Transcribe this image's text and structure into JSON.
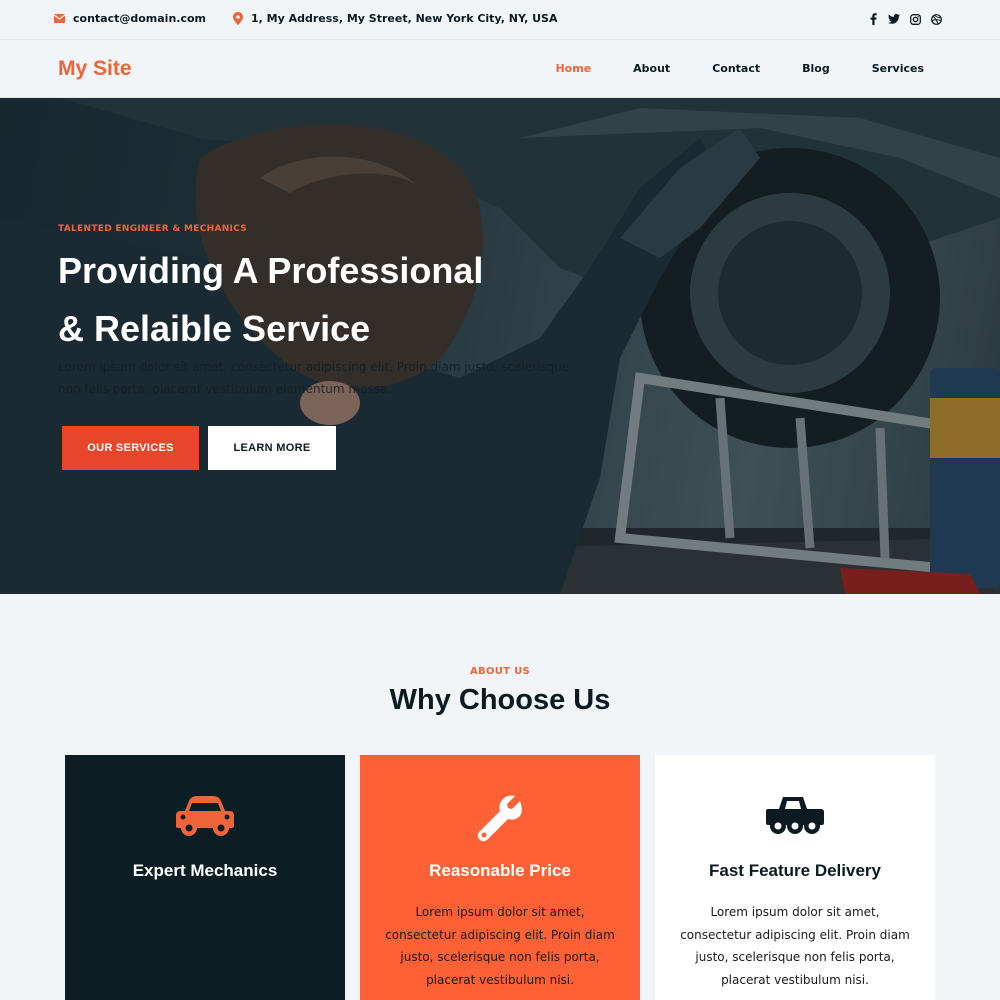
{
  "topbar": {
    "email": "contact@domain.com",
    "address": "1, My Address, My Street, New York City, NY, USA",
    "social": [
      "facebook-icon",
      "twitter-icon",
      "instagram-icon",
      "dribbble-icon"
    ]
  },
  "nav": {
    "brand": "My Site",
    "links": [
      "Home",
      "About",
      "Contact",
      "Blog",
      "Services"
    ],
    "active": "Home"
  },
  "hero": {
    "kicker": "TALENTED ENGINEER & MECHANICS",
    "title_line1": "Providing A Professional",
    "title_line2": "& Relaible Service",
    "text": "Lorem ipsum dolor sit amet, consectetur adipiscing elit. Proin diam justo, scelerisque non felis porta, placerat vestibulum elementum massa.",
    "primary_button": "OUR SERVICES",
    "secondary_button": "LEARN MORE"
  },
  "about": {
    "kicker": "ABOUT US",
    "title": "Why Choose Us",
    "cards": [
      {
        "icon": "car-icon",
        "title": "Expert Mechanics",
        "text": ""
      },
      {
        "icon": "wrench-icon",
        "title": "Reasonable Price",
        "text": "Lorem ipsum dolor sit amet, consectetur adipiscing elit. Proin diam justo, scelerisque non felis porta, placerat vestibulum nisi."
      },
      {
        "icon": "truck-icon",
        "title": "Fast Feature Delivery",
        "text": "Lorem ipsum dolor sit amet, consectetur adipiscing elit. Proin diam justo, scelerisque non felis porta, placerat vestibulum nisi."
      }
    ]
  },
  "colors": {
    "accent": "#f0643a",
    "dark": "#0c1e23",
    "card_orange": "#ff6136"
  }
}
